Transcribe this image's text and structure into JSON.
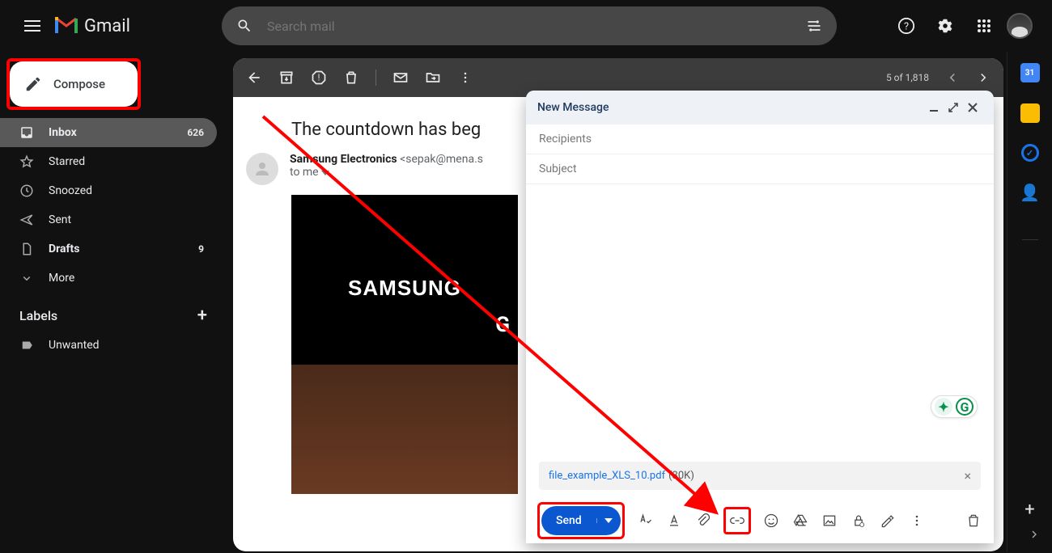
{
  "brand": {
    "name": "Gmail"
  },
  "search": {
    "placeholder": "Search mail"
  },
  "compose": {
    "label": "Compose"
  },
  "sidebar": {
    "items": [
      {
        "label": "Inbox",
        "count": "626"
      },
      {
        "label": "Starred"
      },
      {
        "label": "Snoozed"
      },
      {
        "label": "Sent"
      },
      {
        "label": "Drafts",
        "count": "9"
      },
      {
        "label": "More"
      }
    ],
    "labels_header": "Labels",
    "user_labels": [
      {
        "label": "Unwanted"
      }
    ]
  },
  "toolbar": {
    "count_text": "5 of 1,818"
  },
  "email": {
    "subject": "The countdown has beg",
    "sender_name": "Samsung Electronics",
    "sender_email": "<sepak@mena.s",
    "to_line": "to me",
    "body_brand": "SAMSUNG",
    "body_g": "G"
  },
  "compose_window": {
    "title": "New Message",
    "recipients_placeholder": "Recipients",
    "subject_placeholder": "Subject",
    "attachment": {
      "name": "file_example_XLS_10.pdf",
      "size": "(30K)"
    },
    "send_label": "Send"
  },
  "side_panel": {
    "calendar_day": "31"
  }
}
